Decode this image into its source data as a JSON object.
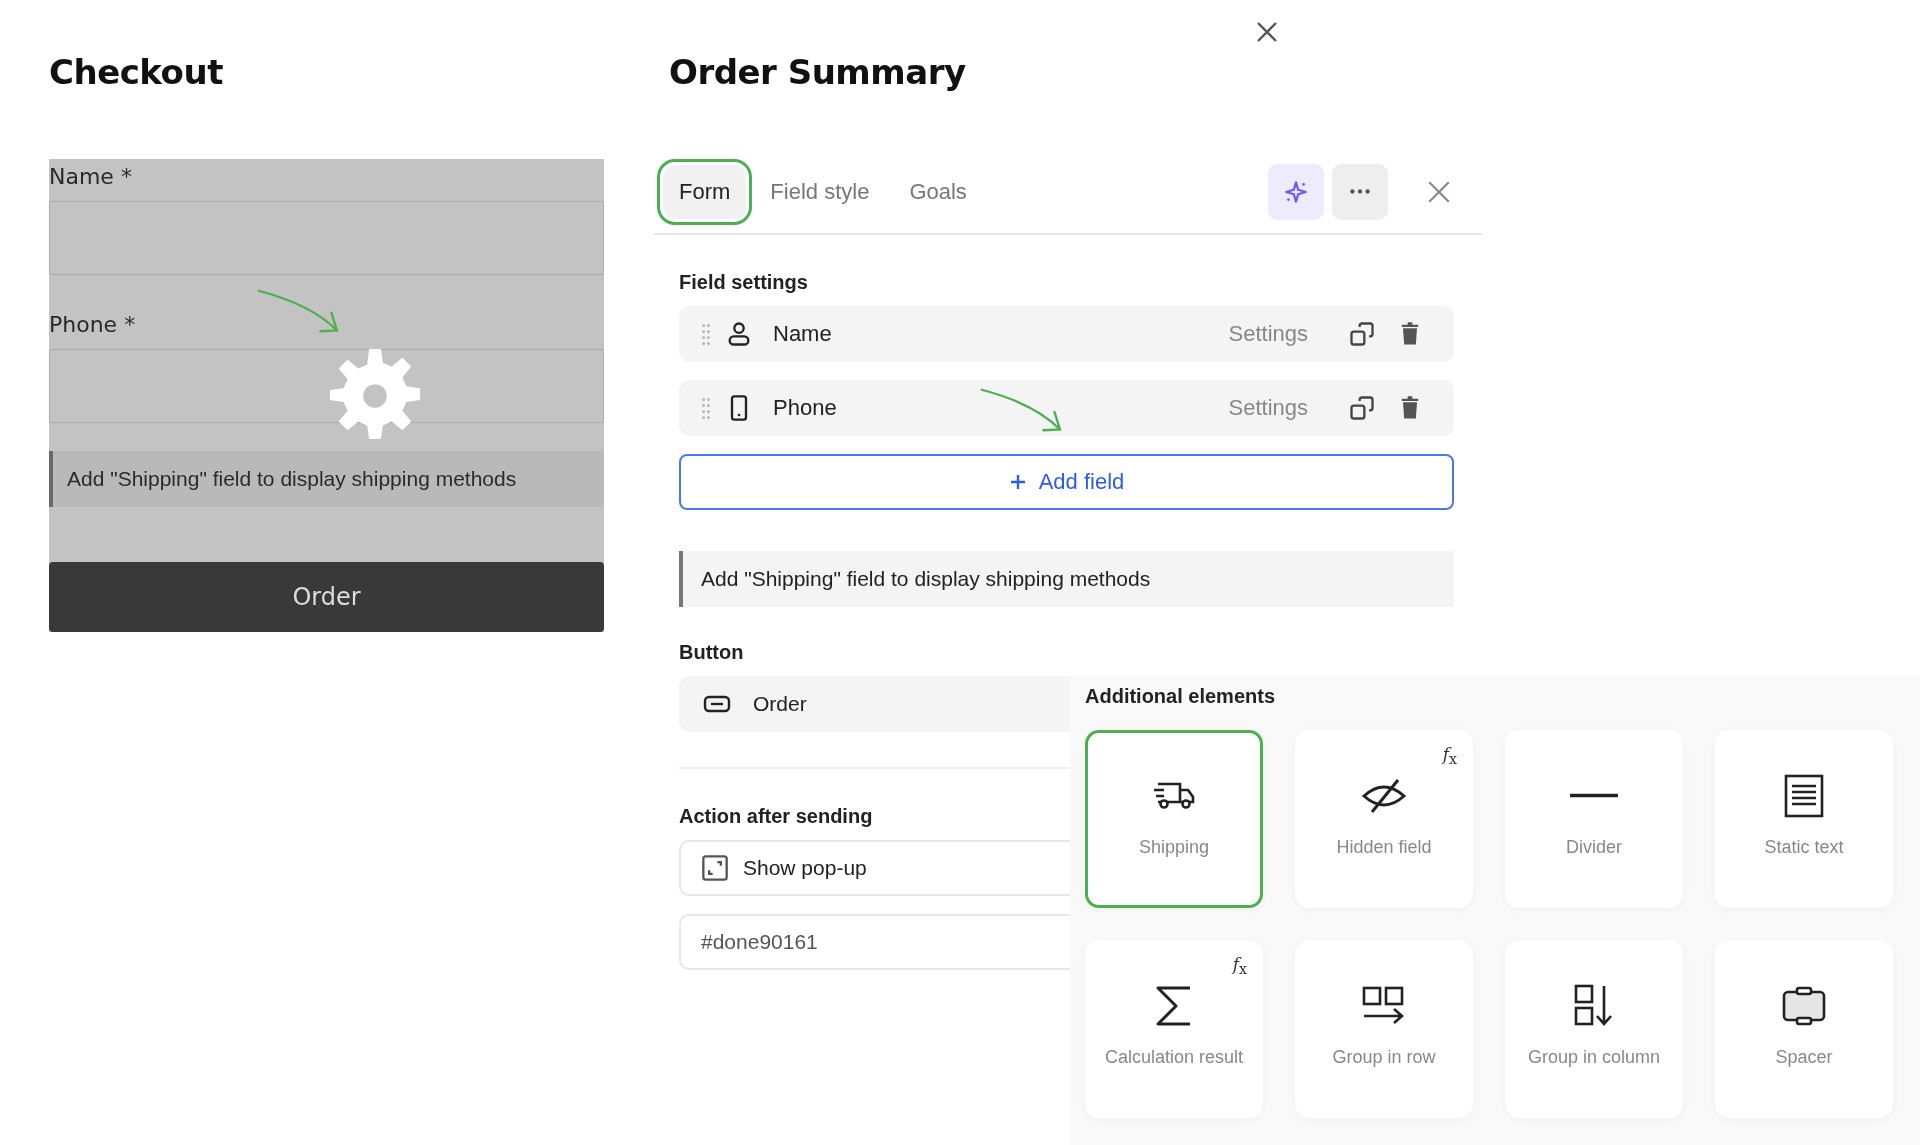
{
  "preview": {
    "title": "Checkout",
    "fields": [
      {
        "label": "Name *"
      },
      {
        "label": "Phone *"
      }
    ],
    "notice": "Add \"Shipping\" field to display shipping methods",
    "submit": "Order"
  },
  "editor": {
    "title": "Order Summary",
    "tabs": [
      {
        "label": "Form",
        "selected": true
      },
      {
        "label": "Field style",
        "selected": false
      },
      {
        "label": "Goals",
        "selected": false
      }
    ],
    "field_settings": {
      "heading": "Field settings",
      "fields": [
        {
          "kind": "person",
          "label": "Name",
          "action": "Settings"
        },
        {
          "kind": "phone",
          "label": "Phone",
          "action": "Settings"
        }
      ],
      "add_button": "Add field"
    },
    "notice": "Add \"Shipping\" field to display shipping methods",
    "button_section": {
      "heading": "Button",
      "label": "Order"
    },
    "action_section": {
      "heading": "Action after sending",
      "action": "Show pop-up",
      "value": "#done90161"
    }
  },
  "additional_elements": {
    "heading": "Additional elements",
    "items": [
      {
        "kind": "truck",
        "label": "Shipping",
        "selected": true
      },
      {
        "kind": "hidden",
        "label": "Hidden field",
        "selected": false,
        "badge": "*f*$_{x}$"
      },
      {
        "kind": "divider",
        "label": "Divider",
        "selected": false
      },
      {
        "kind": "text",
        "label": "Static text",
        "selected": false
      },
      {
        "kind": "sum",
        "label": "Calculation result",
        "selected": false,
        "badge": "*f*$_{x}$"
      },
      {
        "kind": "row",
        "label": "Group in row",
        "selected": false
      },
      {
        "kind": "column",
        "label": "Group in column",
        "selected": false
      },
      {
        "kind": "spacer",
        "label": "Spacer",
        "selected": false
      }
    ]
  }
}
